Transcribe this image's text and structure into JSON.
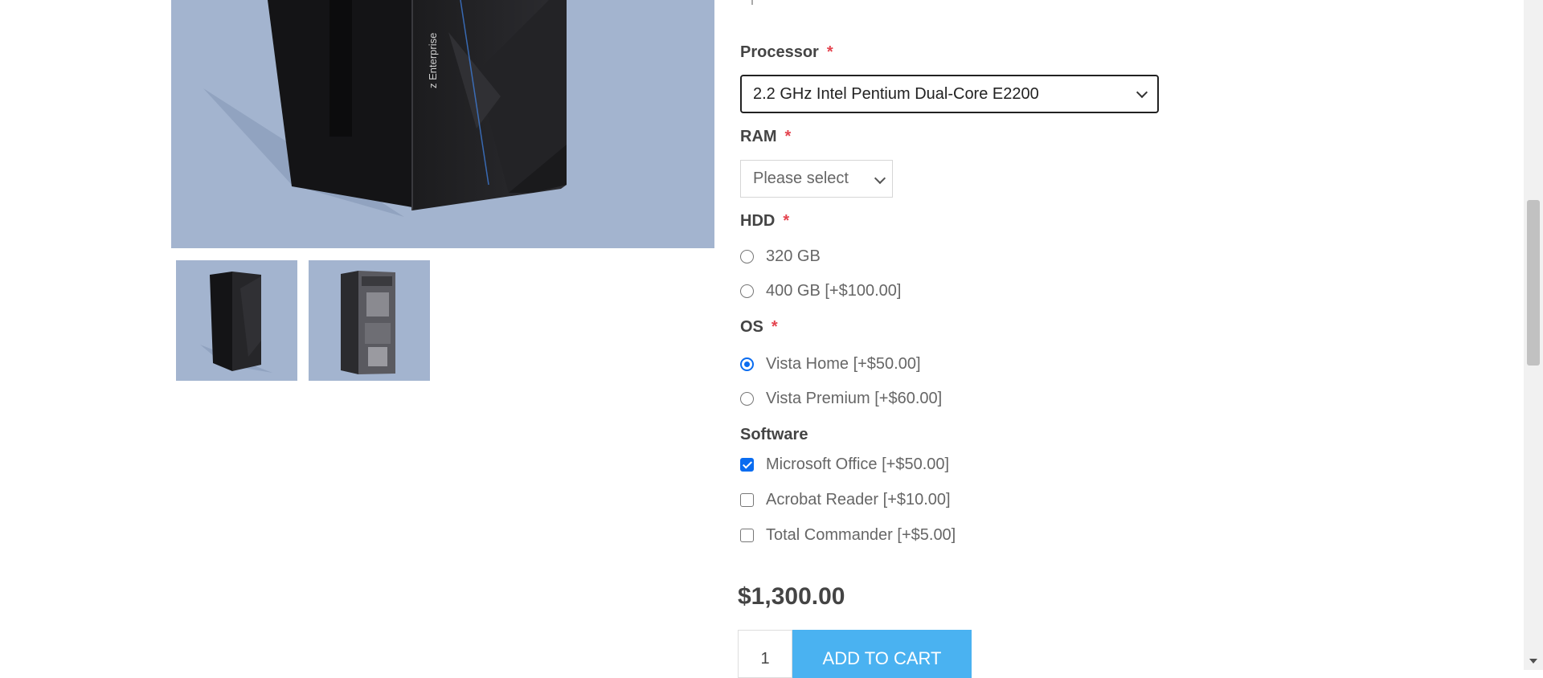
{
  "form": {
    "processor": {
      "label": "Processor",
      "required": "*",
      "selected": "2.2 GHz Intel Pentium Dual-Core E2200"
    },
    "ram": {
      "label": "RAM",
      "required": "*",
      "selected": "Please select"
    },
    "hdd": {
      "label": "HDD",
      "required": "*",
      "options": [
        {
          "label": "320 GB",
          "checked": false
        },
        {
          "label": "400 GB [+$100.00]",
          "checked": false
        }
      ]
    },
    "os": {
      "label": "OS",
      "required": "*",
      "options": [
        {
          "label": "Vista Home [+$50.00]",
          "checked": true
        },
        {
          "label": "Vista Premium [+$60.00]",
          "checked": false
        }
      ]
    },
    "software": {
      "label": "Software",
      "options": [
        {
          "label": "Microsoft Office [+$50.00]",
          "checked": true
        },
        {
          "label": "Acrobat Reader [+$10.00]",
          "checked": false
        },
        {
          "label": "Total Commander [+$5.00]",
          "checked": false
        }
      ]
    }
  },
  "price": "$1,300.00",
  "quantity": "1",
  "add_to_cart_label": "ADD TO CART",
  "product_image": {
    "brand_text": "z Enterprise"
  },
  "icons": {
    "shipping": "box-icon"
  },
  "colors": {
    "accent": "#4ab2f1",
    "required": "#e4444f",
    "image_bg": "#a3b4cf",
    "radio_checked": "#0a6cf0"
  }
}
